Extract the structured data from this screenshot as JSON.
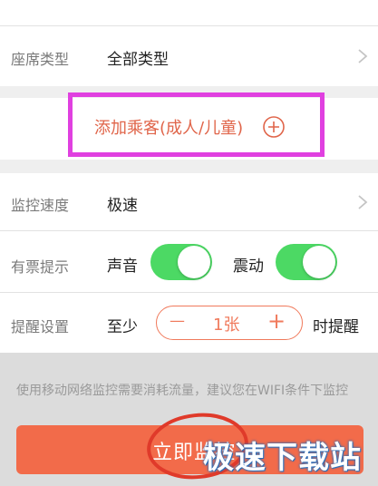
{
  "seat_row": {
    "label": "座席类型",
    "value": "全部类型",
    "chevron_icon": "chevron-right-icon"
  },
  "add_passenger": {
    "label": "添加乘客(成人/儿童)",
    "icon": "plus-circle-icon",
    "accent": "#e0654a",
    "highlight": "#e040e0"
  },
  "speed_row": {
    "label": "监控速度",
    "value": "极速",
    "chevron_icon": "chevron-right-icon"
  },
  "alert_row": {
    "label": "有票提示",
    "sound": {
      "label": "声音",
      "on": true
    },
    "vibrate": {
      "label": "震动",
      "on": true
    }
  },
  "reminder_row": {
    "label": "提醒设置",
    "prefix": "至少",
    "stepper": {
      "minus": "—",
      "value": "1张",
      "plus": "+"
    },
    "suffix": "时提醒"
  },
  "notice": "使用移动网络监控需要消耗流量，建议您在WIFI条件下监控",
  "start_button": {
    "label": "立即监控",
    "color": "#f26b4a"
  },
  "watermark": "极速下载站",
  "colors": {
    "toggle_on": "#4cd964",
    "stepper_border": "#f07a5c"
  }
}
